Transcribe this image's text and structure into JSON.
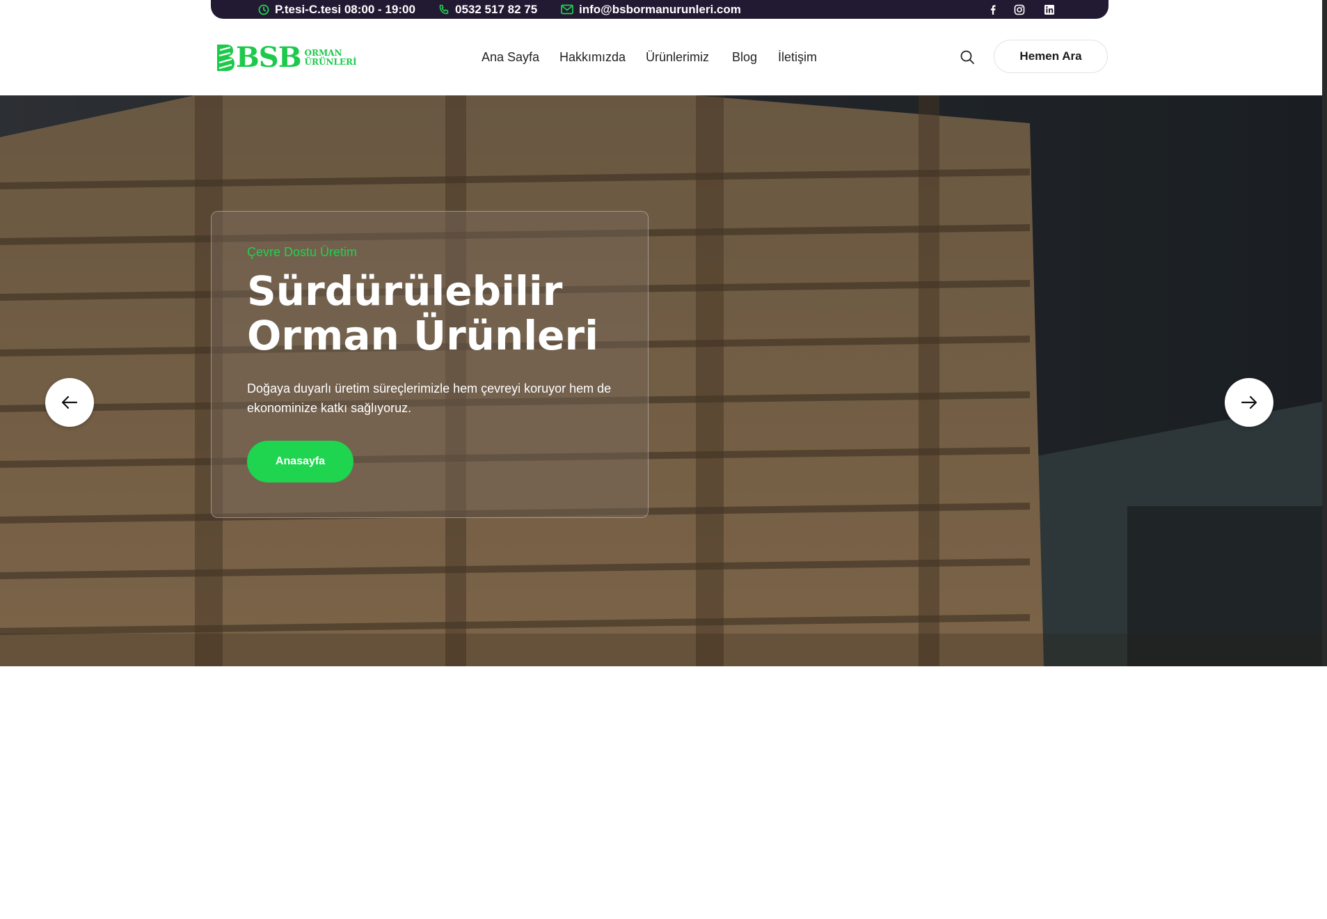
{
  "topbar": {
    "hours": "P.tesi-C.tesi 08:00 - 19:00",
    "phone": "0532 517 82 75",
    "email": "info@bsbormanurunleri.com",
    "social_icons": [
      "facebook-icon",
      "instagram-icon",
      "linkedin-icon"
    ]
  },
  "header": {
    "logo": {
      "text": "BSB",
      "sub_line1": "ORMAN",
      "sub_line2": "ÜRÜNLERİ"
    },
    "nav": [
      "Ana Sayfa",
      "Hakkımızda",
      "Ürünlerimiz",
      "Blog",
      "İletişim"
    ],
    "call_button": "Hemen Ara"
  },
  "hero": {
    "eyebrow": "Çevre Dostu Üretim",
    "title_line1": "Sürdürülebilir",
    "title_line2": "Orman Ürünleri",
    "description": "Doğaya duyarlı üretim süreçlerimizle hem çevreyi koruyor hem de ekonominize katkı sağlıyoruz.",
    "cta": "Anasayfa"
  },
  "colors": {
    "accent": "#1fd44e",
    "topbar_bg": "#221a33"
  }
}
